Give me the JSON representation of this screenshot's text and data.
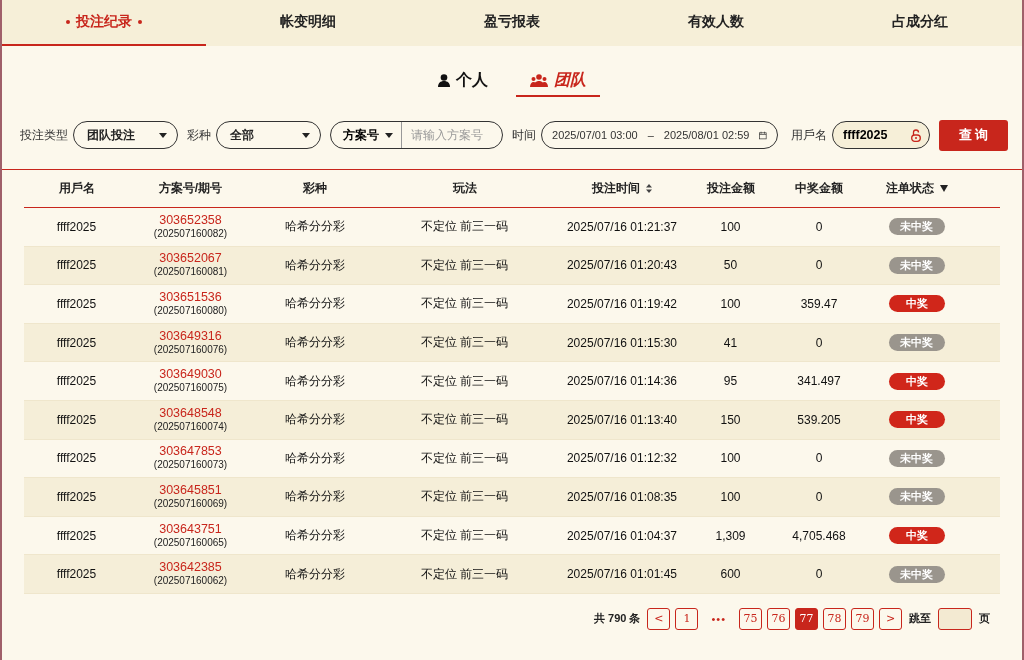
{
  "tabs": [
    {
      "label": "投注纪录",
      "selected": true
    },
    {
      "label": "帐变明细",
      "selected": false
    },
    {
      "label": "盈亏报表",
      "selected": false
    },
    {
      "label": "有效人数",
      "selected": false
    },
    {
      "label": "占成分红",
      "selected": false
    }
  ],
  "subtabs": [
    {
      "label": "个人",
      "kind": "person",
      "selected": false
    },
    {
      "label": "团队",
      "kind": "team",
      "selected": true
    }
  ],
  "filters": {
    "bet_type_label": "投注类型",
    "bet_type": "团队投注",
    "lottery_label": "彩种",
    "lottery": "全部",
    "plan_select": "方案号",
    "plan_placeholder": "请输入方案号",
    "time_label": "时间",
    "time_start": "2025/07/01 03:00",
    "time_sep": "–",
    "time_end": "2025/08/01 02:59",
    "user_label": "用戶名",
    "user": "ffff2025",
    "query_button": "查 询"
  },
  "table": {
    "columns": [
      {
        "label": "用戶名",
        "kind": "plain"
      },
      {
        "label": "方案号/期号",
        "kind": "plain"
      },
      {
        "label": "彩种",
        "kind": "plain"
      },
      {
        "label": "玩法",
        "kind": "plain"
      },
      {
        "label": "投注时间",
        "kind": "sortable"
      },
      {
        "label": "投注金额",
        "kind": "plain"
      },
      {
        "label": "中奖金额",
        "kind": "plain"
      },
      {
        "label": "注单状态",
        "kind": "filterable"
      }
    ],
    "rows": [
      {
        "user": "ffff2025",
        "plan": "303652358",
        "issue": "(202507160082)",
        "lottery": "哈希分分彩",
        "play": "不定位 前三一码",
        "time": "2025/07/16 01:21:37",
        "amount": "100",
        "win": "0",
        "status": "未中奖",
        "won": false
      },
      {
        "user": "ffff2025",
        "plan": "303652067",
        "issue": "(202507160081)",
        "lottery": "哈希分分彩",
        "play": "不定位 前三一码",
        "time": "2025/07/16 01:20:43",
        "amount": "50",
        "win": "0",
        "status": "未中奖",
        "won": false
      },
      {
        "user": "ffff2025",
        "plan": "303651536",
        "issue": "(202507160080)",
        "lottery": "哈希分分彩",
        "play": "不定位 前三一码",
        "time": "2025/07/16 01:19:42",
        "amount": "100",
        "win": "359.47",
        "status": "中奖",
        "won": true
      },
      {
        "user": "ffff2025",
        "plan": "303649316",
        "issue": "(202507160076)",
        "lottery": "哈希分分彩",
        "play": "不定位 前三一码",
        "time": "2025/07/16 01:15:30",
        "amount": "41",
        "win": "0",
        "status": "未中奖",
        "won": false
      },
      {
        "user": "ffff2025",
        "plan": "303649030",
        "issue": "(202507160075)",
        "lottery": "哈希分分彩",
        "play": "不定位 前三一码",
        "time": "2025/07/16 01:14:36",
        "amount": "95",
        "win": "341.497",
        "status": "中奖",
        "won": true
      },
      {
        "user": "ffff2025",
        "plan": "303648548",
        "issue": "(202507160074)",
        "lottery": "哈希分分彩",
        "play": "不定位 前三一码",
        "time": "2025/07/16 01:13:40",
        "amount": "150",
        "win": "539.205",
        "status": "中奖",
        "won": true
      },
      {
        "user": "ffff2025",
        "plan": "303647853",
        "issue": "(202507160073)",
        "lottery": "哈希分分彩",
        "play": "不定位 前三一码",
        "time": "2025/07/16 01:12:32",
        "amount": "100",
        "win": "0",
        "status": "未中奖",
        "won": false
      },
      {
        "user": "ffff2025",
        "plan": "303645851",
        "issue": "(202507160069)",
        "lottery": "哈希分分彩",
        "play": "不定位 前三一码",
        "time": "2025/07/16 01:08:35",
        "amount": "100",
        "win": "0",
        "status": "未中奖",
        "won": false
      },
      {
        "user": "ffff2025",
        "plan": "303643751",
        "issue": "(202507160065)",
        "lottery": "哈希分分彩",
        "play": "不定位 前三一码",
        "time": "2025/07/16 01:04:37",
        "amount": "1,309",
        "win": "4,705.468",
        "status": "中奖",
        "won": true
      },
      {
        "user": "ffff2025",
        "plan": "303642385",
        "issue": "(202507160062)",
        "lottery": "哈希分分彩",
        "play": "不定位 前三一码",
        "time": "2025/07/16 01:01:45",
        "amount": "600",
        "win": "0",
        "status": "未中奖",
        "won": false
      }
    ]
  },
  "pagination": {
    "total": "共 790 条",
    "prev": "<",
    "first_pages": [
      {
        "label": "1",
        "selected": false
      }
    ],
    "ellipsis": "•••",
    "pages": [
      {
        "label": "75",
        "selected": false
      },
      {
        "label": "76",
        "selected": false
      },
      {
        "label": "77",
        "selected": true
      },
      {
        "label": "78",
        "selected": false
      },
      {
        "label": "79",
        "selected": false
      }
    ],
    "next": ">",
    "jump_label": "跳至",
    "jump_suffix": "页"
  }
}
